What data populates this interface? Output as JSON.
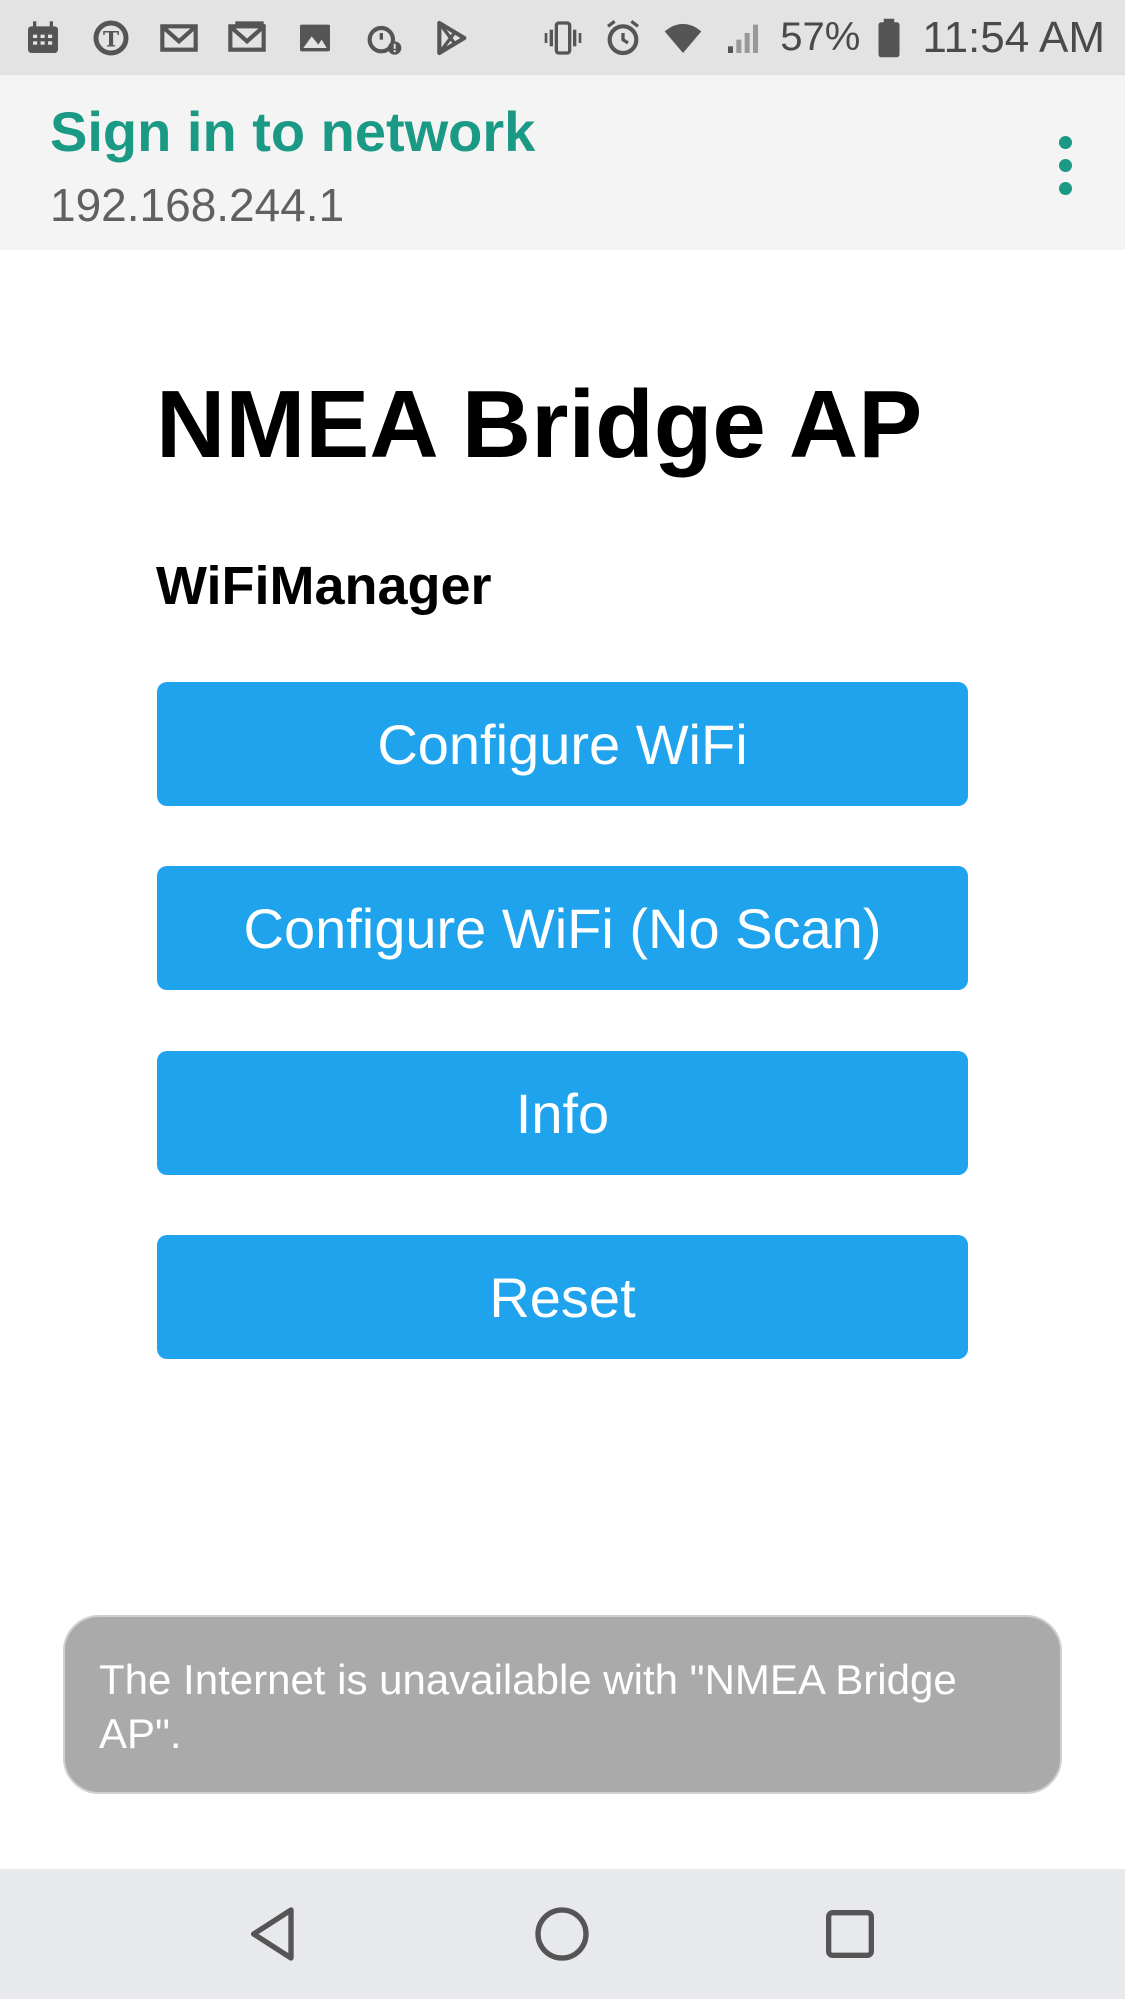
{
  "status_bar": {
    "left_icons": [
      "calendar-icon",
      "nytimes-icon",
      "gmail-icon",
      "gmail-icon",
      "gallery-icon",
      "alarm-alert-icon",
      "play-store-icon"
    ],
    "right_icons": [
      "vibrate-icon",
      "alarm-icon",
      "wifi-no-internet-icon",
      "signal-icon",
      "battery-icon"
    ],
    "battery_percent": "57%",
    "time": "11:54 AM"
  },
  "header": {
    "title": "Sign in to network",
    "subtitle": "192.168.244.1",
    "menu_icon": "more-vert-icon"
  },
  "page": {
    "title": "NMEA Bridge AP",
    "subtitle": "WiFiManager",
    "buttons": [
      {
        "label": "Configure WiFi"
      },
      {
        "label": "Configure WiFi (No Scan)"
      },
      {
        "label": "Info"
      },
      {
        "label": "Reset"
      }
    ]
  },
  "toast": {
    "message": "The Internet is unavailable with \"NMEA Bridge AP\"."
  },
  "nav_bar": {
    "icons": [
      "back-icon",
      "home-icon",
      "recents-icon"
    ]
  },
  "colors": {
    "accent": "#1a9984",
    "button": "#1fa3ec",
    "toast": "#aaaaaa"
  }
}
